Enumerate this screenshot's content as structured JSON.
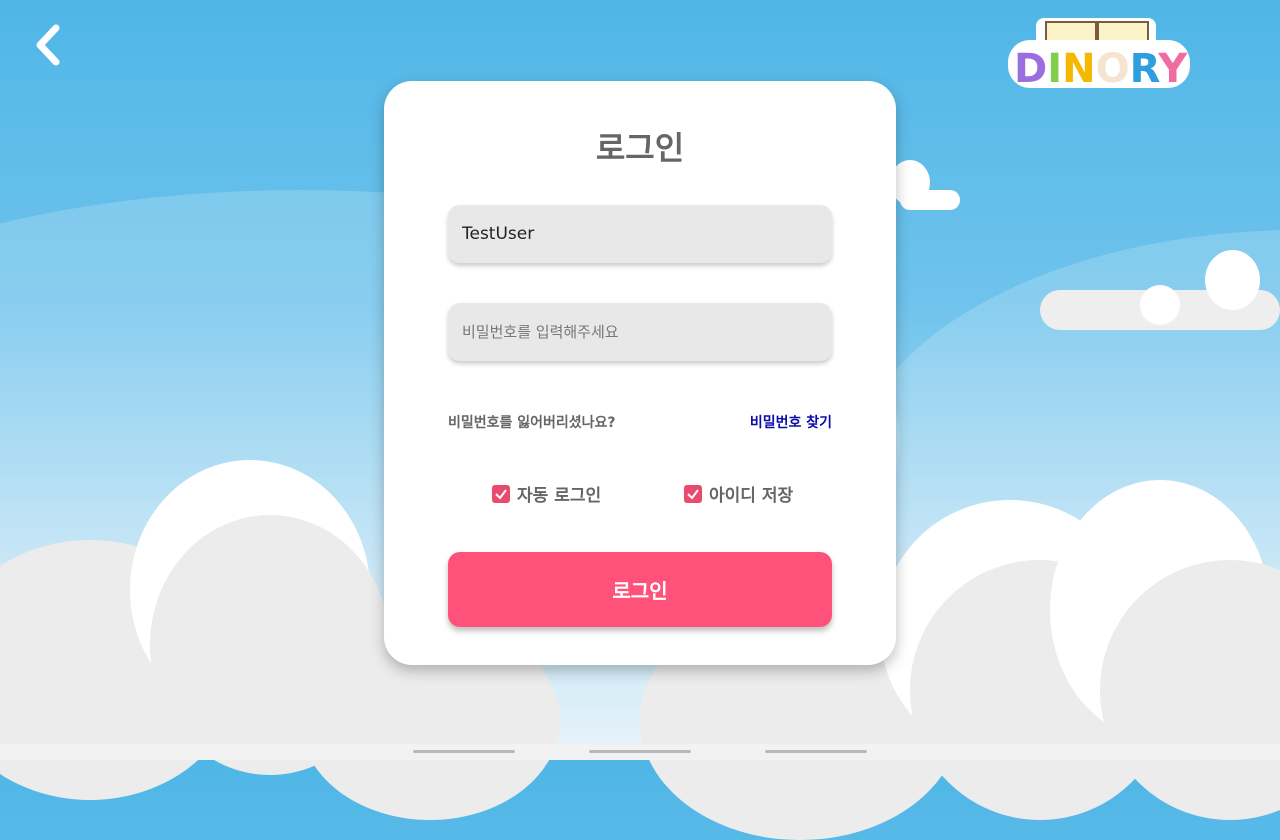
{
  "logo_text": "DINORY",
  "login": {
    "title": "로그인",
    "username_value": "TestUser",
    "password_placeholder": "비밀번호를 입력해주세요",
    "forgot_text": "비밀번호를 잃어버리셨나요?",
    "find_password": "비밀번호 찾기",
    "auto_login": "자동 로그인",
    "save_id": "아이디 저장",
    "submit": "로그인"
  },
  "colors": {
    "accent": "#ff527b",
    "link": "#0b0ba8",
    "sky": "#4fb6e6"
  }
}
